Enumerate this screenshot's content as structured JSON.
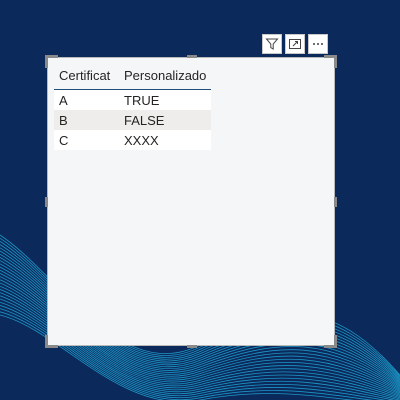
{
  "toolbar": {
    "filter_icon": "filter-icon",
    "focus_icon": "focus-mode-icon",
    "more_icon": "more-options-icon"
  },
  "table": {
    "columns": [
      "Certificat",
      "Personalizado"
    ],
    "rows": [
      [
        "A",
        "TRUE"
      ],
      [
        "B",
        "FALSE"
      ],
      [
        "C",
        "XXXX"
      ]
    ]
  },
  "colors": {
    "background": "#0b2a5b",
    "wave": "#1fa8d8",
    "header_rule": "#1f4e79"
  }
}
